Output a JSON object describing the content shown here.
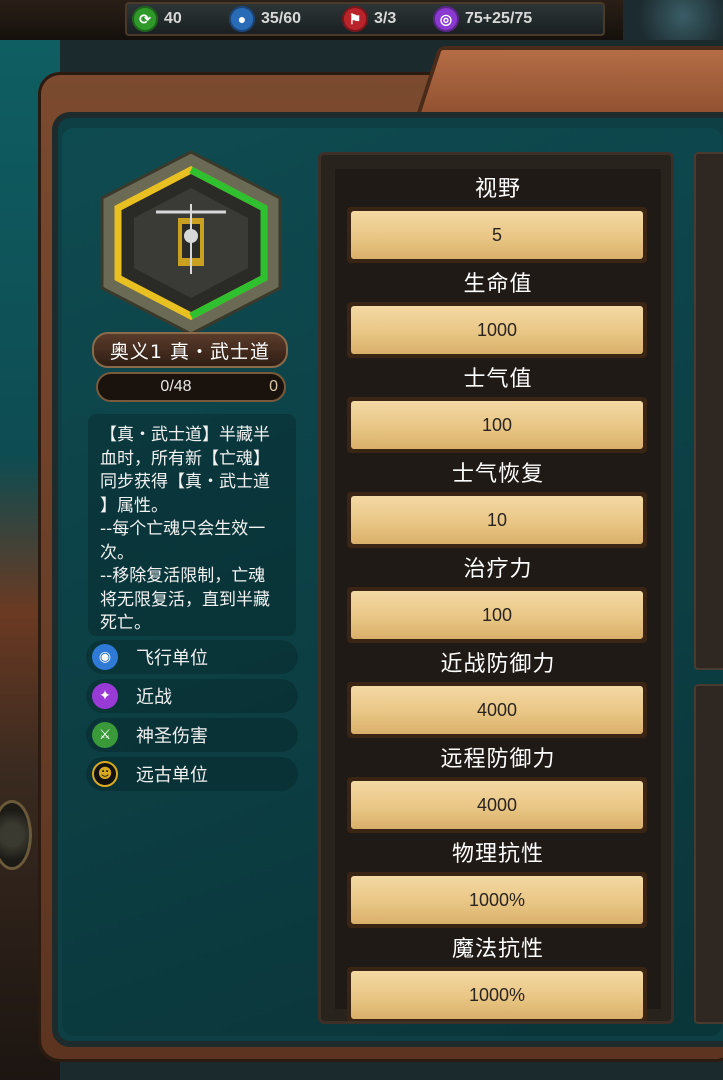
{
  "resources": [
    {
      "icon": "energy-icon",
      "value": "40",
      "color": "#2f9a2a"
    },
    {
      "icon": "population-icon",
      "value": "35/60",
      "color": "#2a6bb8"
    },
    {
      "icon": "command-icon",
      "value": "3/3",
      "color": "#b8242a"
    },
    {
      "icon": "magic-icon",
      "value": "75+25/75",
      "color": "#8a3ad0"
    }
  ],
  "hero": {
    "name": "奥义1 真・武士道",
    "xp_text": "0/48",
    "xp_fraction": 0,
    "level": "0",
    "description": "【真・武士道】半藏半\n血时，所有新【亡魂】\n同步获得【真・武士道\n】属性。\n--每个亡魂只会生效一\n次。\n--移除复活限制，亡魂\n将无限复活，直到半藏\n死亡。"
  },
  "tags": [
    {
      "icon": "flying-unit-icon",
      "label": "飞行单位",
      "color": "#2f7ad6"
    },
    {
      "icon": "melee-icon",
      "label": "近战",
      "color": "#9a3ad6"
    },
    {
      "icon": "holy-damage-icon",
      "label": "神圣伤害",
      "color": "#3a9a3a"
    },
    {
      "icon": "ancient-unit-icon",
      "label": "远古单位",
      "color": "#111111"
    }
  ],
  "stats": [
    {
      "name": "视野",
      "value": "5"
    },
    {
      "name": "生命值",
      "value": "1000"
    },
    {
      "name": "士气值",
      "value": "100"
    },
    {
      "name": "士气恢复",
      "value": "10"
    },
    {
      "name": "治疗力",
      "value": "100"
    },
    {
      "name": "近战防御力",
      "value": "4000"
    },
    {
      "name": "远程防御力",
      "value": "4000"
    },
    {
      "name": "物理抗性",
      "value": "1000%"
    },
    {
      "name": "魔法抗性",
      "value": "1000%"
    }
  ]
}
